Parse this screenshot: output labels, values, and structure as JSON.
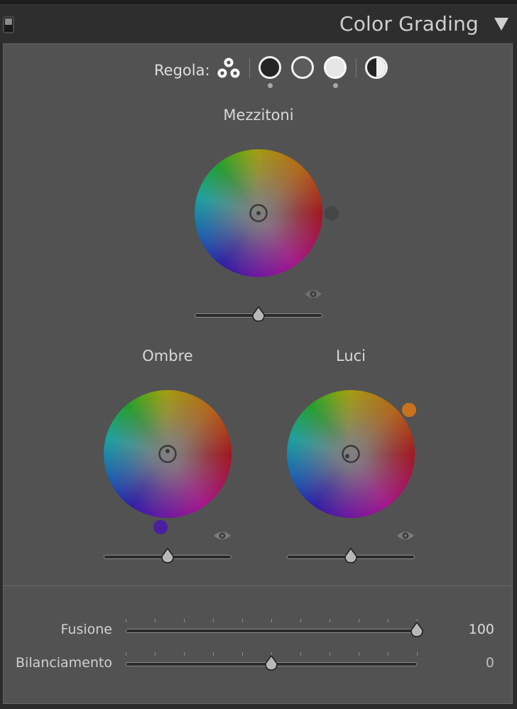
{
  "header": {
    "title": "Color Grading",
    "collapse_icon": "triangle-down-icon",
    "toggle_icon": "panel-switch-icon"
  },
  "toolbar": {
    "label": "Regola:",
    "tools": [
      {
        "name": "three-way-icon"
      },
      {
        "name": "shadows-icon",
        "active": true
      },
      {
        "name": "midtones-icon"
      },
      {
        "name": "highlights-icon",
        "active": true
      },
      {
        "name": "global-icon"
      }
    ]
  },
  "wheels": {
    "midtones": {
      "label": "Mezzitoni",
      "slider": 0.5
    },
    "shadows": {
      "label": "Ombre",
      "slider": 0.5,
      "dot_color": "#4a1fa0"
    },
    "highlights": {
      "label": "Luci",
      "slider": 0.5,
      "dot_color": "#c8721e"
    }
  },
  "global": {
    "fusione": {
      "label": "Fusione",
      "value": "100",
      "position": 1.0
    },
    "bilanciamento": {
      "label": "Bilanciamento",
      "value": "0",
      "position": 0.5
    }
  },
  "colors": {
    "panel_bg": "#525252",
    "header_bg": "#2e2e2e",
    "text": "#d8d8d8"
  }
}
